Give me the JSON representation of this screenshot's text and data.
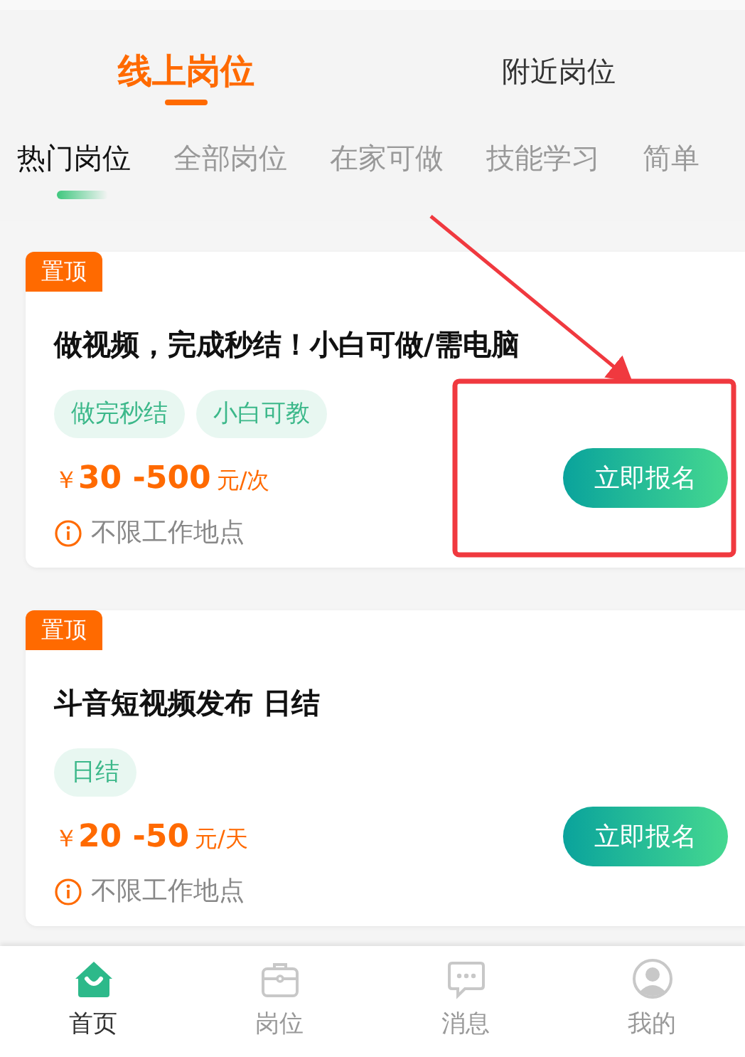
{
  "main_tabs": [
    {
      "label": "线上岗位",
      "selected": true
    },
    {
      "label": "附近岗位",
      "selected": false
    }
  ],
  "category_tabs": [
    {
      "label": "热门岗位",
      "selected": true
    },
    {
      "label": "全部岗位",
      "selected": false
    },
    {
      "label": "在家可做",
      "selected": false
    },
    {
      "label": "技能学习",
      "selected": false
    },
    {
      "label": "简单",
      "selected": false
    }
  ],
  "jobs": [
    {
      "badge": "置顶",
      "title": "做视频，完成秒结！小白可做/需电脑",
      "tags": [
        "做完秒结",
        "小白可教"
      ],
      "currency": "￥",
      "salary": "30 -500",
      "unit": "元/次",
      "location": "不限工作地点",
      "button": "立即报名"
    },
    {
      "badge": "置顶",
      "title": "斗音短视频发布 日结",
      "tags": [
        "日结"
      ],
      "currency": "￥",
      "salary": "20 -50",
      "unit": "元/天",
      "location": "不限工作地点",
      "button": "立即报名"
    }
  ],
  "bottom_nav": [
    {
      "label": "首页",
      "kind": "home",
      "selected": true
    },
    {
      "label": "岗位",
      "kind": "briefcase",
      "selected": false
    },
    {
      "label": "消息",
      "kind": "chat",
      "selected": false
    },
    {
      "label": "我的",
      "kind": "profile",
      "selected": false
    }
  ]
}
